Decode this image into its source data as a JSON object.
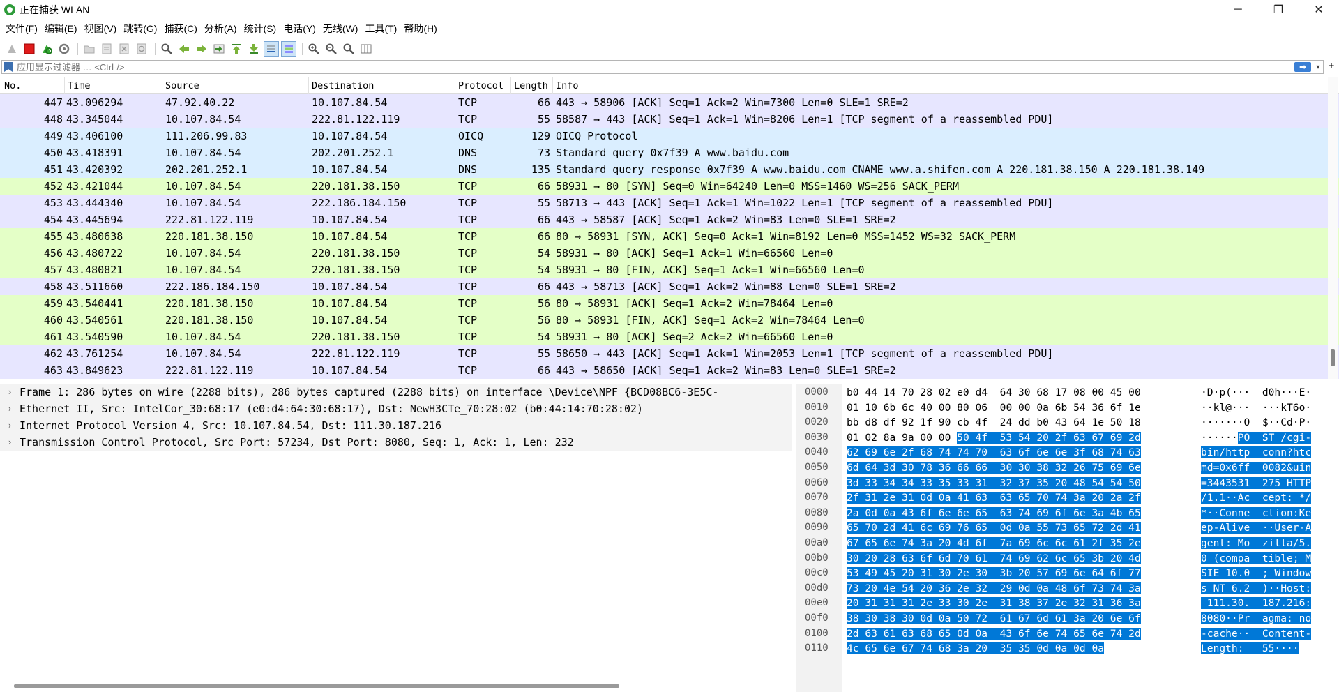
{
  "window": {
    "title": "正在捕获 WLAN",
    "minimize": "─",
    "maximize": "❐",
    "close": "✕"
  },
  "menu": [
    "文件(F)",
    "编辑(E)",
    "视图(V)",
    "跳转(G)",
    "捕获(C)",
    "分析(A)",
    "统计(S)",
    "电话(Y)",
    "无线(W)",
    "工具(T)",
    "帮助(H)"
  ],
  "filter": {
    "placeholder": "应用显示过滤器 … <Ctrl-/>",
    "apply_label": "➡",
    "dropdown": "▾",
    "add_label": "+"
  },
  "columns": {
    "no": "No.",
    "time": "Time",
    "source": "Source",
    "destination": "Destination",
    "protocol": "Protocol",
    "length": "Length",
    "info": "Info"
  },
  "packets": [
    {
      "no": "447",
      "time": "43.096294",
      "src": "47.92.40.22",
      "dst": "10.107.84.54",
      "proto": "TCP",
      "len": "66",
      "info": "443 → 58906 [ACK] Seq=1 Ack=2 Win=7300 Len=0 SLE=1 SRE=2",
      "color": "purple"
    },
    {
      "no": "448",
      "time": "43.345044",
      "src": "10.107.84.54",
      "dst": "222.81.122.119",
      "proto": "TCP",
      "len": "55",
      "info": "58587 → 443 [ACK] Seq=1 Ack=1 Win=8206 Len=1 [TCP segment of a reassembled PDU]",
      "color": "purple"
    },
    {
      "no": "449",
      "time": "43.406100",
      "src": "111.206.99.83",
      "dst": "10.107.84.54",
      "proto": "OICQ",
      "len": "129",
      "info": "OICQ Protocol",
      "color": "blue"
    },
    {
      "no": "450",
      "time": "43.418391",
      "src": "10.107.84.54",
      "dst": "202.201.252.1",
      "proto": "DNS",
      "len": "73",
      "info": "Standard query 0x7f39 A www.baidu.com",
      "color": "blue"
    },
    {
      "no": "451",
      "time": "43.420392",
      "src": "202.201.252.1",
      "dst": "10.107.84.54",
      "proto": "DNS",
      "len": "135",
      "info": "Standard query response 0x7f39 A www.baidu.com CNAME www.a.shifen.com A 220.181.38.150 A 220.181.38.149",
      "color": "blue"
    },
    {
      "no": "452",
      "time": "43.421044",
      "src": "10.107.84.54",
      "dst": "220.181.38.150",
      "proto": "TCP",
      "len": "66",
      "info": "58931 → 80 [SYN] Seq=0 Win=64240 Len=0 MSS=1460 WS=256 SACK_PERM",
      "color": "green"
    },
    {
      "no": "453",
      "time": "43.444340",
      "src": "10.107.84.54",
      "dst": "222.186.184.150",
      "proto": "TCP",
      "len": "55",
      "info": "58713 → 443 [ACK] Seq=1 Ack=1 Win=1022 Len=1 [TCP segment of a reassembled PDU]",
      "color": "purple"
    },
    {
      "no": "454",
      "time": "43.445694",
      "src": "222.81.122.119",
      "dst": "10.107.84.54",
      "proto": "TCP",
      "len": "66",
      "info": "443 → 58587 [ACK] Seq=1 Ack=2 Win=83 Len=0 SLE=1 SRE=2",
      "color": "purple"
    },
    {
      "no": "455",
      "time": "43.480638",
      "src": "220.181.38.150",
      "dst": "10.107.84.54",
      "proto": "TCP",
      "len": "66",
      "info": "80 → 58931 [SYN, ACK] Seq=0 Ack=1 Win=8192 Len=0 MSS=1452 WS=32 SACK_PERM",
      "color": "green"
    },
    {
      "no": "456",
      "time": "43.480722",
      "src": "10.107.84.54",
      "dst": "220.181.38.150",
      "proto": "TCP",
      "len": "54",
      "info": "58931 → 80 [ACK] Seq=1 Ack=1 Win=66560 Len=0",
      "color": "green"
    },
    {
      "no": "457",
      "time": "43.480821",
      "src": "10.107.84.54",
      "dst": "220.181.38.150",
      "proto": "TCP",
      "len": "54",
      "info": "58931 → 80 [FIN, ACK] Seq=1 Ack=1 Win=66560 Len=0",
      "color": "green"
    },
    {
      "no": "458",
      "time": "43.511660",
      "src": "222.186.184.150",
      "dst": "10.107.84.54",
      "proto": "TCP",
      "len": "66",
      "info": "443 → 58713 [ACK] Seq=1 Ack=2 Win=88 Len=0 SLE=1 SRE=2",
      "color": "purple"
    },
    {
      "no": "459",
      "time": "43.540441",
      "src": "220.181.38.150",
      "dst": "10.107.84.54",
      "proto": "TCP",
      "len": "56",
      "info": "80 → 58931 [ACK] Seq=1 Ack=2 Win=78464 Len=0",
      "color": "green"
    },
    {
      "no": "460",
      "time": "43.540561",
      "src": "220.181.38.150",
      "dst": "10.107.84.54",
      "proto": "TCP",
      "len": "56",
      "info": "80 → 58931 [FIN, ACK] Seq=1 Ack=2 Win=78464 Len=0",
      "color": "green"
    },
    {
      "no": "461",
      "time": "43.540590",
      "src": "10.107.84.54",
      "dst": "220.181.38.150",
      "proto": "TCP",
      "len": "54",
      "info": "58931 → 80 [ACK] Seq=2 Ack=2 Win=66560 Len=0",
      "color": "green"
    },
    {
      "no": "462",
      "time": "43.761254",
      "src": "10.107.84.54",
      "dst": "222.81.122.119",
      "proto": "TCP",
      "len": "55",
      "info": "58650 → 443 [ACK] Seq=1 Ack=1 Win=2053 Len=1 [TCP segment of a reassembled PDU]",
      "color": "purple"
    },
    {
      "no": "463",
      "time": "43.849623",
      "src": "222.81.122.119",
      "dst": "10.107.84.54",
      "proto": "TCP",
      "len": "66",
      "info": "443 → 58650 [ACK] Seq=1 Ack=2 Win=83 Len=0 SLE=1 SRE=2",
      "color": "purple"
    }
  ],
  "details": [
    "Frame 1: 286 bytes on wire (2288 bits), 286 bytes captured (2288 bits) on interface \\Device\\NPF_{BCD08BC6-3E5C-",
    "Ethernet II, Src: IntelCor_30:68:17 (e0:d4:64:30:68:17), Dst: NewH3CTe_70:28:02 (b0:44:14:70:28:02)",
    "Internet Protocol Version 4, Src: 10.107.84.54, Dst: 111.30.187.216",
    "Transmission Control Protocol, Src Port: 57234, Dst Port: 8080, Seq: 1, Ack: 1, Len: 232"
  ],
  "bytes": [
    {
      "offset": "0000",
      "hex": "b0 44 14 70 28 02 e0 d4  64 30 68 17 08 00 45 00",
      "ascii": "·D·p(···  d0h···E·"
    },
    {
      "offset": "0010",
      "hex": "01 10 6b 6c 40 00 80 06  00 00 0a 6b 54 36 6f 1e",
      "ascii": "··kl@···  ···kT6o·"
    },
    {
      "offset": "0020",
      "hex": "bb d8 df 92 1f 90 cb 4f  24 dd b0 43 64 1e 50 18",
      "ascii": "·······O  $··Cd·P·"
    },
    {
      "offset": "0030",
      "hex": "01 02 8a 9a 00 00 50 4f  53 54 20 2f 63 67 69 2d",
      "ascii": "······PO  ST /cgi-"
    },
    {
      "offset": "0040",
      "hex": "62 69 6e 2f 68 74 74 70  63 6f 6e 6e 3f 68 74 63",
      "ascii": "bin/http  conn?htc"
    },
    {
      "offset": "0050",
      "hex": "6d 64 3d 30 78 36 66 66  30 30 38 32 26 75 69 6e",
      "ascii": "md=0x6ff  0082&uin"
    },
    {
      "offset": "0060",
      "hex": "3d 33 34 34 33 35 33 31  32 37 35 20 48 54 54 50",
      "ascii": "=3443531  275 HTTP"
    },
    {
      "offset": "0070",
      "hex": "2f 31 2e 31 0d 0a 41 63  63 65 70 74 3a 20 2a 2f",
      "ascii": "/1.1··Ac  cept: */"
    },
    {
      "offset": "0080",
      "hex": "2a 0d 0a 43 6f 6e 6e 65  63 74 69 6f 6e 3a 4b 65",
      "ascii": "*··Conne  ction:Ke"
    },
    {
      "offset": "0090",
      "hex": "65 70 2d 41 6c 69 76 65  0d 0a 55 73 65 72 2d 41",
      "ascii": "ep-Alive  ··User-A"
    },
    {
      "offset": "00a0",
      "hex": "67 65 6e 74 3a 20 4d 6f  7a 69 6c 6c 61 2f 35 2e",
      "ascii": "gent: Mo  zilla/5."
    },
    {
      "offset": "00b0",
      "hex": "30 20 28 63 6f 6d 70 61  74 69 62 6c 65 3b 20 4d",
      "ascii": "0 (compa  tible; M"
    },
    {
      "offset": "00c0",
      "hex": "53 49 45 20 31 30 2e 30  3b 20 57 69 6e 64 6f 77",
      "ascii": "SIE 10.0  ; Window"
    },
    {
      "offset": "00d0",
      "hex": "73 20 4e 54 20 36 2e 32  29 0d 0a 48 6f 73 74 3a",
      "ascii": "s NT 6.2  )··Host:"
    },
    {
      "offset": "00e0",
      "hex": "20 31 31 31 2e 33 30 2e  31 38 37 2e 32 31 36 3a",
      "ascii": " 111.30.  187.216:"
    },
    {
      "offset": "00f0",
      "hex": "38 30 38 30 0d 0a 50 72  61 67 6d 61 3a 20 6e 6f",
      "ascii": "8080··Pr  agma: no"
    },
    {
      "offset": "0100",
      "hex": "2d 63 61 63 68 65 0d 0a  43 6f 6e 74 65 6e 74 2d",
      "ascii": "-cache··  Content-"
    },
    {
      "offset": "0110",
      "hex": "4c 65 6e 67 74 68 3a 20  35 35 0d 0a 0d 0a",
      "ascii": "Length:   55····"
    }
  ],
  "colors": {
    "tcp_purple": "#e7e6ff",
    "tcp_green": "#e4ffc7",
    "udp_blue": "#daeeff",
    "selection": "#0078d7"
  }
}
